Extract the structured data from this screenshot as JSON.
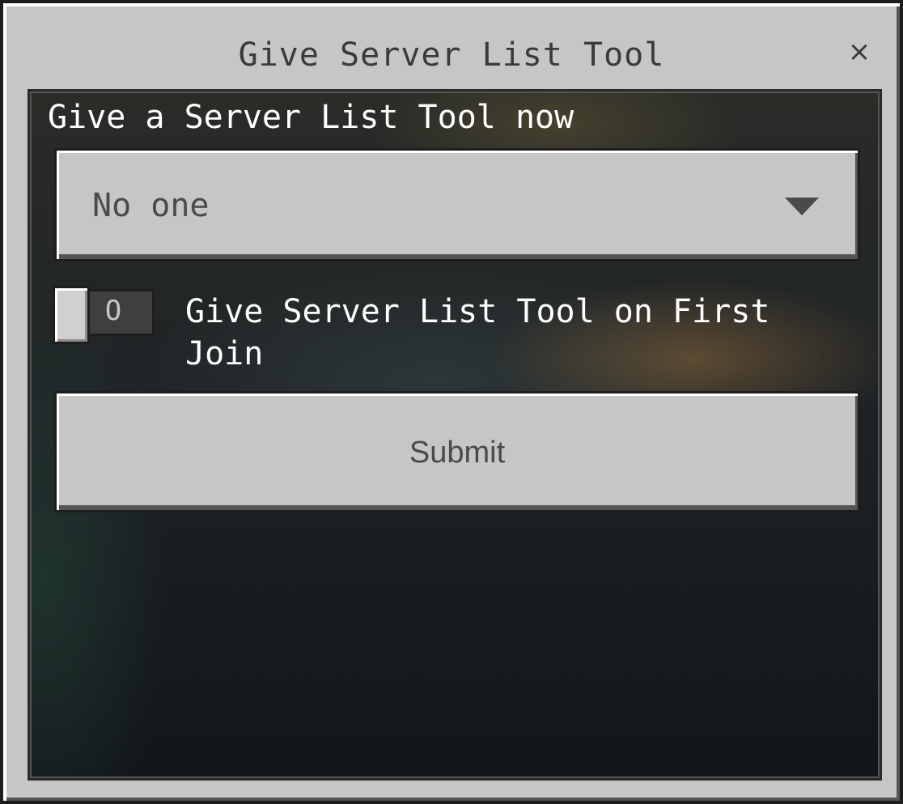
{
  "dialog": {
    "title": "Give Server List Tool",
    "close_glyph": "×"
  },
  "form": {
    "section_label": "Give a Server List Tool now",
    "dropdown": {
      "selected": "No one",
      "arrow_icon": "chevron-down-icon"
    },
    "toggle": {
      "state": "off",
      "off_glyph": "O",
      "label": "Give Server List Tool on First Join"
    },
    "submit_label": "Submit"
  }
}
